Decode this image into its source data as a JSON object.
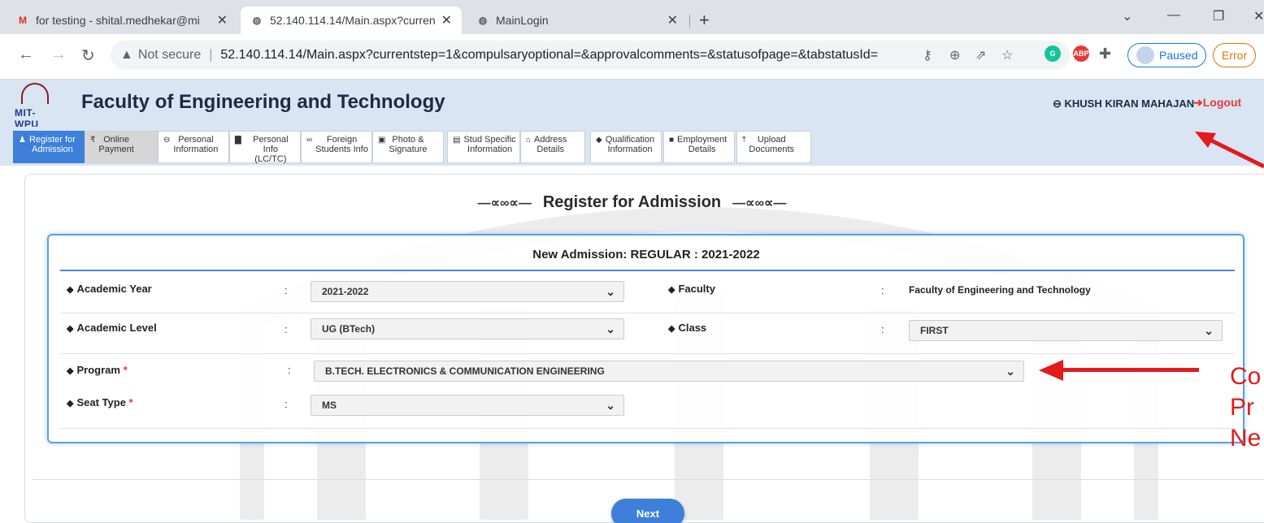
{
  "browser": {
    "tabs": [
      {
        "title": "for testing - shital.medhekar@mi",
        "favicon": "gmail-icon"
      },
      {
        "title": "52.140.114.14/Main.aspx?currentst",
        "favicon": "globe-icon"
      },
      {
        "title": "MainLogin",
        "favicon": "globe-icon"
      }
    ],
    "new_tab": "+",
    "url_security": "Not secure",
    "url": "52.140.114.14/Main.aspx?currentstep=1&compulsaryoptional=&approvalcomments=&statusofpage=&tabstatusId=",
    "paused_label": "Paused",
    "error_label": "Error"
  },
  "app": {
    "logo_text": "MIT-WPU",
    "title": "Faculty of Engineering and Technology",
    "user_name": "KHUSH KIRAN MAHAJAN",
    "logout_label": "Logout"
  },
  "menu": [
    {
      "icon": "users-icon",
      "line1": "Register for",
      "line2": "Admission"
    },
    {
      "icon": "rupee-icon",
      "line1": "Online",
      "line2": "Payment"
    },
    {
      "icon": "user-icon",
      "line1": "Personal",
      "line2": "Information"
    },
    {
      "icon": "building-icon",
      "line1": "Personal Info",
      "line2": "(LC/TC)"
    },
    {
      "icon": "glasses-icon",
      "line1": "Foreign",
      "line2": "Students Info"
    },
    {
      "icon": "picture-icon",
      "line1": "Photo &",
      "line2": "Signature"
    },
    {
      "icon": "id-card-icon",
      "line1": "Stud Specific",
      "line2": "Information"
    },
    {
      "icon": "home-icon",
      "line1": "Address",
      "line2": "Details"
    },
    {
      "icon": "graduation-cap-icon",
      "line1": "Qualification",
      "line2": "Information"
    },
    {
      "icon": "briefcase-icon",
      "line1": "Employment",
      "line2": "Details"
    },
    {
      "icon": "upload-icon",
      "line1": "Upload",
      "line2": "Documents"
    }
  ],
  "page": {
    "heading": "Register for Admission",
    "form_title": "New Admission: REGULAR : 2021-2022",
    "fields": {
      "academic_year": {
        "label": "Academic Year",
        "value": "2021-2022"
      },
      "faculty": {
        "label": "Faculty",
        "value": "Faculty of Engineering and Technology"
      },
      "academic_level": {
        "label": "Academic Level",
        "value": "UG (BTech)"
      },
      "class": {
        "label": "Class",
        "value": "FIRST"
      },
      "program": {
        "label": "Program",
        "required": "*",
        "value": "B.TECH. ELECTRONICS & COMMUNICATION ENGINEERING"
      },
      "seat_type": {
        "label": "Seat Type",
        "required": "*",
        "value": "MS"
      }
    },
    "colon": ":",
    "next_label": "Next"
  },
  "annotation": {
    "lines": [
      "Co",
      "Pr",
      "Ne"
    ],
    "color": "#e21b1b"
  },
  "colors": {
    "header_bg": "#d9e5f3",
    "active_tab": "#3d7fd9",
    "form_border": "#5b9fe5",
    "logout": "#e53935"
  }
}
